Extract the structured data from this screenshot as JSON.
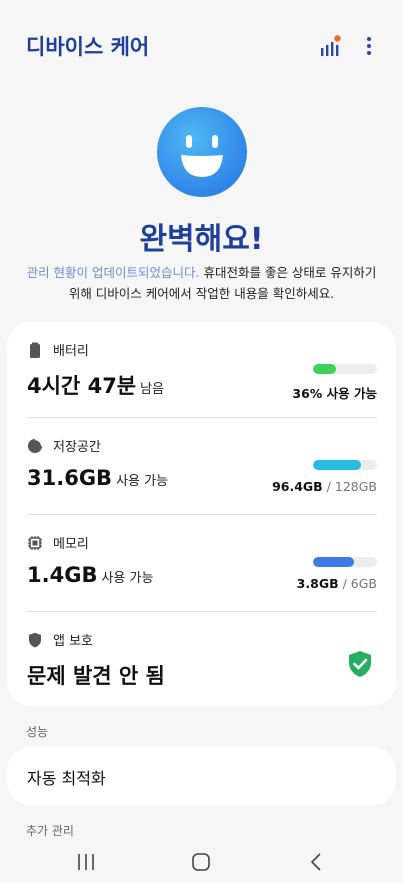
{
  "header": {
    "title": "디바이스 케어",
    "report_icon": "signal-report-icon",
    "more_icon": "more-vertical-icon"
  },
  "hero": {
    "face_icon": "smiley-face-icon",
    "title": "완벽해요!",
    "desc_highlight": "관리 현황이 업데이트되었습니다.",
    "desc_rest": " 휴대전화를 좋은 상태로 유지하기 위해 디바이스 케어에서 작업한 내용을 확인하세요."
  },
  "battery": {
    "label": "배터리",
    "icon": "battery-icon",
    "hours": "4시간",
    "minutes": "47분",
    "remaining_label": "남음",
    "percent": 36,
    "status": "36% 사용 가능",
    "bar_color": "#3dd05a"
  },
  "storage": {
    "label": "저장공간",
    "icon": "pie-chart-icon",
    "available": "31.6GB",
    "available_label": "사용 가능",
    "used": "96.4GB",
    "separator": " / ",
    "total": "128GB",
    "fill_fraction": 0.753,
    "bar_color": "#28bde0"
  },
  "memory": {
    "label": "메모리",
    "icon": "memory-chip-icon",
    "available": "1.4GB",
    "available_label": "사용 가능",
    "used": "3.8GB",
    "separator": " / ",
    "total": "6GB",
    "fill_fraction": 0.633,
    "bar_color": "#3e7ae6"
  },
  "protection": {
    "label": "앱 보호",
    "icon": "shield-icon",
    "status": "문제 발견 안 됨",
    "status_icon": "shield-check-icon",
    "status_color": "#27ae60"
  },
  "performance": {
    "section_label": "성능",
    "item": "자동 최적화"
  },
  "extra": {
    "section_label": "추가 관리"
  },
  "nav": {
    "recents_icon": "recents-icon",
    "home_icon": "home-icon",
    "back_icon": "back-icon"
  }
}
